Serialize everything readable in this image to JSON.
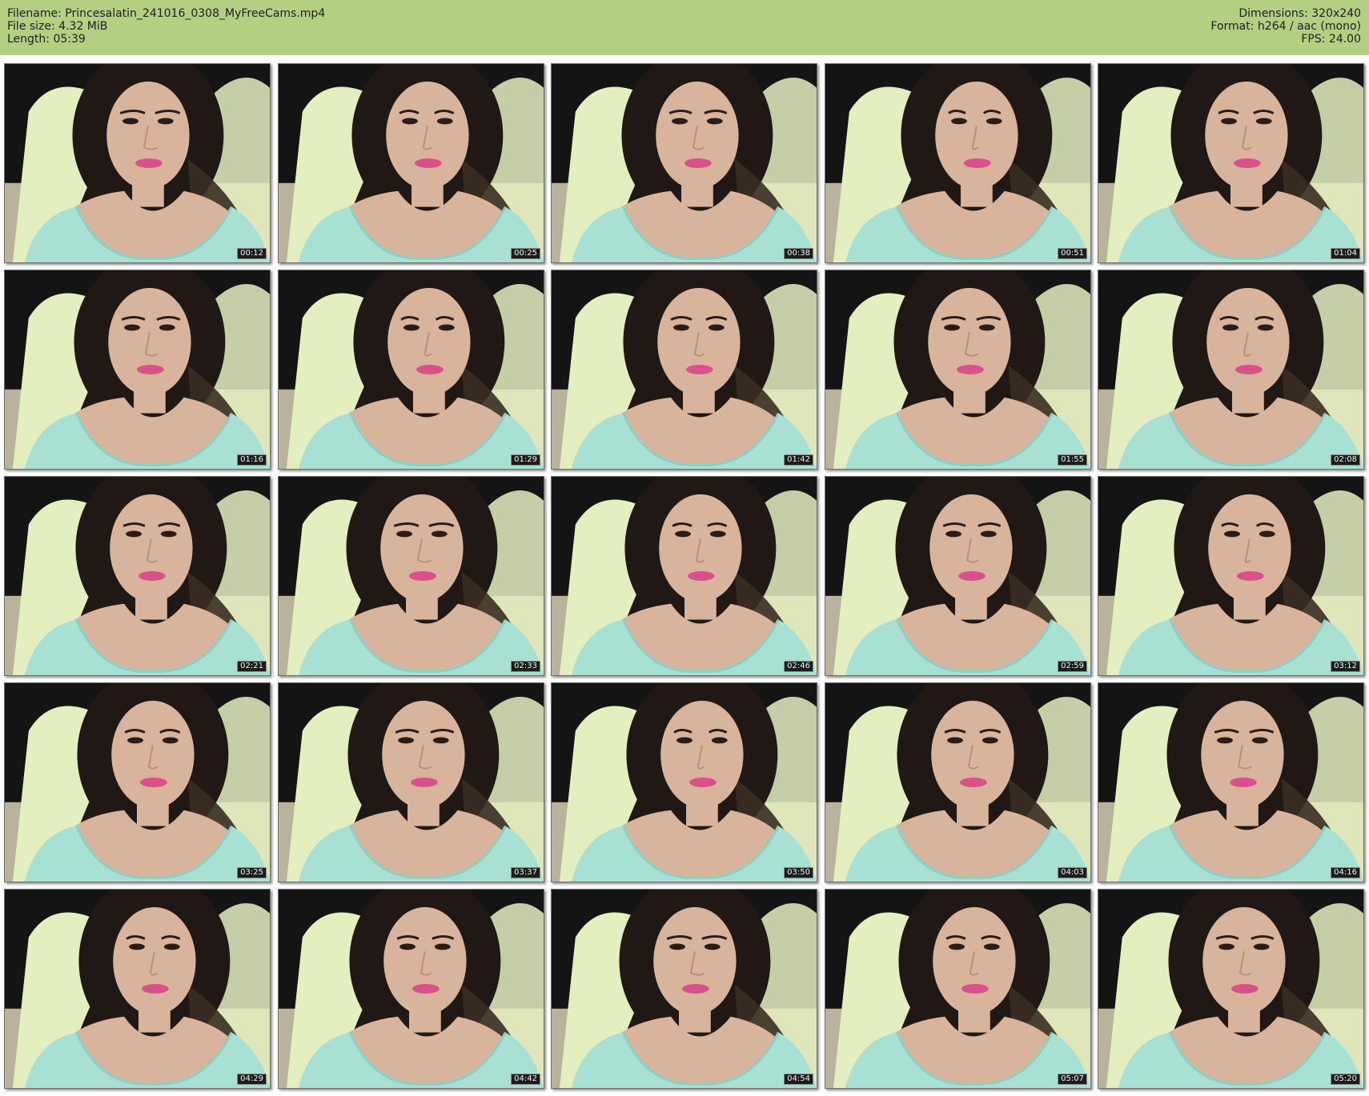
{
  "header": {
    "filename": "Filename: Princesalatin_241016_0308_MyFreeCams.mp4",
    "filesize": "File size: 4.32 MiB",
    "length": "Length: 05:39",
    "dimensions": "Dimensions: 320x240",
    "format": "Format: h264 / aac (mono)",
    "fps": "FPS: 24.00"
  },
  "thumbnails": [
    {
      "time": "00:12"
    },
    {
      "time": "00:25"
    },
    {
      "time": "00:38"
    },
    {
      "time": "00:51"
    },
    {
      "time": "01:04"
    },
    {
      "time": "01:16"
    },
    {
      "time": "01:29"
    },
    {
      "time": "01:42"
    },
    {
      "time": "01:55"
    },
    {
      "time": "02:08"
    },
    {
      "time": "02:21"
    },
    {
      "time": "02:33"
    },
    {
      "time": "02:46"
    },
    {
      "time": "02:59"
    },
    {
      "time": "03:12"
    },
    {
      "time": "03:25"
    },
    {
      "time": "03:37"
    },
    {
      "time": "03:50"
    },
    {
      "time": "04:03"
    },
    {
      "time": "04:16"
    },
    {
      "time": "04:29"
    },
    {
      "time": "04:42"
    },
    {
      "time": "04:54"
    },
    {
      "time": "05:07"
    },
    {
      "time": "05:20"
    }
  ],
  "colors": {
    "header_bg": "#b2cf82",
    "timestamp_bg": "#1c1c1c",
    "top_color": "#a8e0d4",
    "skin_color": "#d9b49c",
    "hair_color": "#1f1814",
    "pillow_color": "#e4efc0",
    "lip_color": "#d9508c"
  }
}
